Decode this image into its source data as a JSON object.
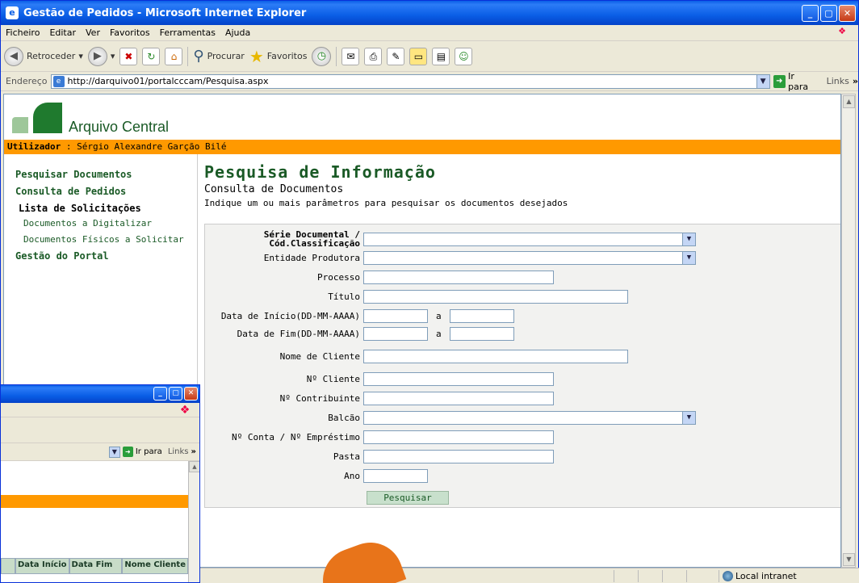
{
  "window": {
    "title": "Gestão de Pedidos - Microsoft Internet Explorer",
    "min": "_",
    "max": "▢",
    "close": "✕"
  },
  "menu": [
    "Ficheiro",
    "Editar",
    "Ver",
    "Favoritos",
    "Ferramentas",
    "Ajuda"
  ],
  "toolbar": {
    "back": "Retroceder",
    "search": "Procurar",
    "favorites": "Favoritos"
  },
  "address": {
    "label": "Endereço",
    "url": "http://darquivo01/portalcccam/Pesquisa.aspx",
    "go": "Ir para",
    "links": "Links"
  },
  "brand": {
    "name": "Arquivo Central",
    "accent": "#ff9900",
    "green": "#1f7a2e"
  },
  "user": {
    "label": "Utilizador",
    "name": " : Sérgio Alexandre Garção Bilé"
  },
  "sidebar": {
    "items": [
      {
        "label": "Pesquisar Documentos"
      },
      {
        "label": "Consulta de Pedidos"
      },
      {
        "label": "Lista de Solicitações"
      },
      {
        "label": "Documentos a Digitalizar"
      },
      {
        "label": "Documentos Físicos a Solicitar"
      },
      {
        "label": "Gestão do Portal"
      }
    ]
  },
  "main": {
    "title": "Pesquisa de Informação",
    "subtitle": "Consulta de Documentos",
    "instructions": "Indique um ou mais parâmetros para pesquisar os documentos desejados"
  },
  "form": {
    "serie": "Série Documental /",
    "serie2": "Cód.Classificação",
    "entidade": "Entidade Produtora",
    "processo": "Processo",
    "titulo": "Título",
    "data_inicio": "Data de Início(DD-MM-AAAA)",
    "data_fim": "Data de Fim(DD-MM-AAAA)",
    "a": "a",
    "nome_cliente": "Nome de Cliente",
    "num_cliente": "Nº Cliente",
    "contribuinte": "Nº Contribuinte",
    "balcao": "Balcão",
    "conta": "Nº Conta / Nº Empréstimo",
    "pasta": "Pasta",
    "ano": "Ano",
    "submit": "Pesquisar"
  },
  "status": {
    "zone": "Local intranet"
  },
  "window2": {
    "go": "Ir para",
    "links": "Links",
    "columns": [
      "Data Início",
      "Data Fim",
      "Nome Cliente"
    ]
  }
}
